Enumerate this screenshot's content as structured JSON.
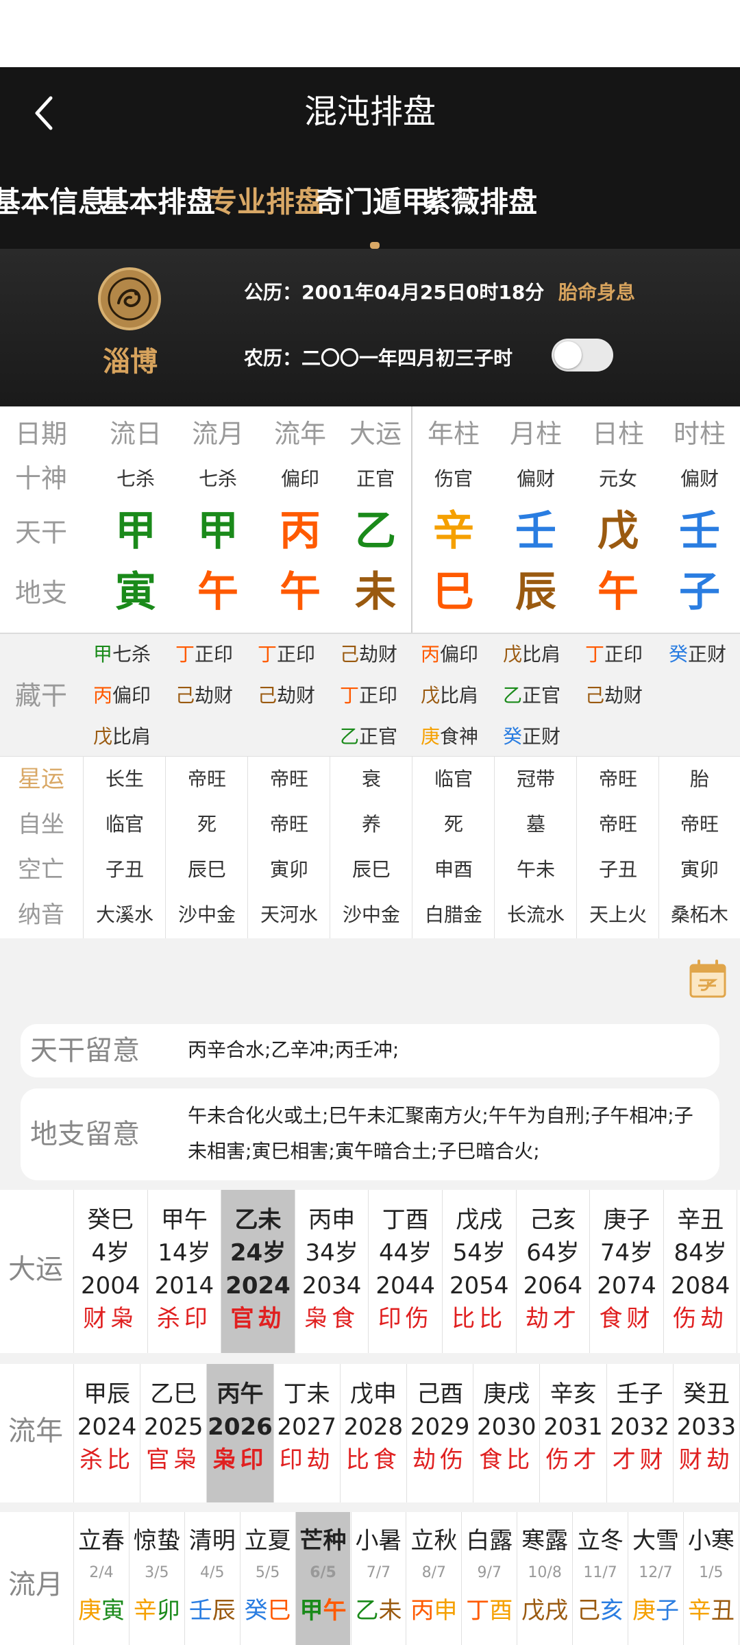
{
  "header": {
    "title": "混沌排盘",
    "back_icon": "chevron-left-icon"
  },
  "tabs": [
    {
      "label": "基本信息",
      "active": false
    },
    {
      "label": "基本排盘",
      "active": false
    },
    {
      "label": "专业排盘",
      "active": true
    },
    {
      "label": "奇门遁甲",
      "active": false
    },
    {
      "label": "紫薇排盘",
      "active": false
    }
  ],
  "info": {
    "place": "淄博",
    "solar": "公历：2001年04月25日0时18分",
    "fetus_label": "胎命身息",
    "lunar": "农历：二〇〇一年四月初三子时",
    "toggle_on": false
  },
  "pillars": {
    "headers": [
      "日期",
      "流日",
      "流月",
      "流年",
      "大运",
      "年柱",
      "月柱",
      "日柱",
      "时柱"
    ],
    "gods_label": "十神",
    "gods": [
      "七杀",
      "七杀",
      "偏印",
      "正官",
      "伤官",
      "偏财",
      "元女",
      "偏财"
    ],
    "stems_label": "天干",
    "stems": [
      {
        "t": "甲",
        "c": "#1a8a1a"
      },
      {
        "t": "甲",
        "c": "#1a8a1a"
      },
      {
        "t": "丙",
        "c": "#ff5a00"
      },
      {
        "t": "乙",
        "c": "#1a8a1a"
      },
      {
        "t": "辛",
        "c": "#f5a000"
      },
      {
        "t": "壬",
        "c": "#2a7de1"
      },
      {
        "t": "戊",
        "c": "#9a5a10"
      },
      {
        "t": "壬",
        "c": "#2a7de1"
      }
    ],
    "branches_label": "地支",
    "branches": [
      {
        "t": "寅",
        "c": "#1a8a1a"
      },
      {
        "t": "午",
        "c": "#ff5a00"
      },
      {
        "t": "午",
        "c": "#ff5a00"
      },
      {
        "t": "未",
        "c": "#9a5a10"
      },
      {
        "t": "巳",
        "c": "#ff5a00"
      },
      {
        "t": "辰",
        "c": "#9a5a10"
      },
      {
        "t": "午",
        "c": "#ff5a00"
      },
      {
        "t": "子",
        "c": "#2a7de1"
      }
    ]
  },
  "hidden": {
    "label": "藏干",
    "columns": [
      [
        {
          "s": "甲",
          "c": "#1a8a1a",
          "g": "七杀"
        },
        {
          "s": "丙",
          "c": "#ff5a00",
          "g": "偏印"
        },
        {
          "s": "戊",
          "c": "#9a5a10",
          "g": "比肩"
        }
      ],
      [
        {
          "s": "丁",
          "c": "#ff5a00",
          "g": "正印"
        },
        {
          "s": "己",
          "c": "#9a5a10",
          "g": "劫财"
        }
      ],
      [
        {
          "s": "丁",
          "c": "#ff5a00",
          "g": "正印"
        },
        {
          "s": "己",
          "c": "#9a5a10",
          "g": "劫财"
        }
      ],
      [
        {
          "s": "己",
          "c": "#9a5a10",
          "g": "劫财"
        },
        {
          "s": "丁",
          "c": "#ff5a00",
          "g": "正印"
        },
        {
          "s": "乙",
          "c": "#1a8a1a",
          "g": "正官"
        }
      ],
      [
        {
          "s": "丙",
          "c": "#ff5a00",
          "g": "偏印"
        },
        {
          "s": "戊",
          "c": "#9a5a10",
          "g": "比肩"
        },
        {
          "s": "庚",
          "c": "#f5a000",
          "g": "食神"
        }
      ],
      [
        {
          "s": "戊",
          "c": "#9a5a10",
          "g": "比肩"
        },
        {
          "s": "乙",
          "c": "#1a8a1a",
          "g": "正官"
        },
        {
          "s": "癸",
          "c": "#2a7de1",
          "g": "正财"
        }
      ],
      [
        {
          "s": "丁",
          "c": "#ff5a00",
          "g": "正印"
        },
        {
          "s": "己",
          "c": "#9a5a10",
          "g": "劫财"
        }
      ],
      [
        {
          "s": "癸",
          "c": "#2a7de1",
          "g": "正财"
        }
      ]
    ]
  },
  "fate": {
    "labels": [
      "星运",
      "自坐",
      "空亡",
      "纳音"
    ],
    "label_colors": [
      "#d9a866",
      "#999999",
      "#999999",
      "#999999"
    ],
    "rows": [
      [
        "长生",
        "帝旺",
        "帝旺",
        "衰",
        "临官",
        "冠带",
        "帝旺",
        "胎"
      ],
      [
        "临官",
        "死",
        "帝旺",
        "养",
        "死",
        "墓",
        "帝旺",
        "帝旺"
      ],
      [
        "子丑",
        "辰巳",
        "寅卯",
        "辰巳",
        "申酉",
        "午未",
        "子丑",
        "寅卯"
      ],
      [
        "大溪水",
        "沙中金",
        "天河水",
        "沙中金",
        "白腊金",
        "长流水",
        "天上火",
        "桑柘木"
      ]
    ]
  },
  "notes": {
    "calendar_icon": "calendar-icon",
    "stem_label": "天干留意",
    "stem_text": "丙辛合水;乙辛冲;丙壬冲;",
    "branch_label": "地支留意",
    "branch_text": "午未合化火或土;巳午未汇聚南方火;午午为自刑;子午相冲;子未相害;寅巳相害;寅午暗合土;子巳暗合火;"
  },
  "dayun": {
    "label": "大运",
    "items": [
      {
        "gz": "癸巳",
        "age": "4岁",
        "year": "2004",
        "god": "财枭"
      },
      {
        "gz": "甲午",
        "age": "14岁",
        "year": "2014",
        "god": "杀印"
      },
      {
        "gz": "乙未",
        "age": "24岁",
        "year": "2024",
        "god": "官劫",
        "selected": true
      },
      {
        "gz": "丙申",
        "age": "34岁",
        "year": "2034",
        "god": "枭食"
      },
      {
        "gz": "丁酉",
        "age": "44岁",
        "year": "2044",
        "god": "印伤"
      },
      {
        "gz": "戊戌",
        "age": "54岁",
        "year": "2054",
        "god": "比比"
      },
      {
        "gz": "己亥",
        "age": "64岁",
        "year": "2064",
        "god": "劫才"
      },
      {
        "gz": "庚子",
        "age": "74岁",
        "year": "2074",
        "god": "食财"
      },
      {
        "gz": "辛丑",
        "age": "84岁",
        "year": "2084",
        "god": "伤劫"
      }
    ]
  },
  "liunian": {
    "label": "流年",
    "items": [
      {
        "gz": "甲辰",
        "year": "2024",
        "god": "杀比"
      },
      {
        "gz": "乙巳",
        "year": "2025",
        "god": "官枭"
      },
      {
        "gz": "丙午",
        "year": "2026",
        "god": "枭印",
        "selected": true
      },
      {
        "gz": "丁未",
        "year": "2027",
        "god": "印劫"
      },
      {
        "gz": "戊申",
        "year": "2028",
        "god": "比食"
      },
      {
        "gz": "己酉",
        "year": "2029",
        "god": "劫伤"
      },
      {
        "gz": "庚戌",
        "year": "2030",
        "god": "食比"
      },
      {
        "gz": "辛亥",
        "year": "2031",
        "god": "伤才"
      },
      {
        "gz": "壬子",
        "year": "2032",
        "god": "才财"
      },
      {
        "gz": "癸丑",
        "year": "2033",
        "god": "财劫"
      }
    ]
  },
  "liuyue": {
    "label": "流月",
    "items": [
      {
        "term": "立春",
        "date": "2/4",
        "s": "庚",
        "sc": "#f5a000",
        "b": "寅",
        "bc": "#1a8a1a"
      },
      {
        "term": "惊蛰",
        "date": "3/5",
        "s": "辛",
        "sc": "#f5a000",
        "b": "卯",
        "bc": "#1a8a1a"
      },
      {
        "term": "清明",
        "date": "4/5",
        "s": "壬",
        "sc": "#2a7de1",
        "b": "辰",
        "bc": "#9a5a10"
      },
      {
        "term": "立夏",
        "date": "5/5",
        "s": "癸",
        "sc": "#2a7de1",
        "b": "巳",
        "bc": "#ff5a00"
      },
      {
        "term": "芒种",
        "date": "6/5",
        "s": "甲",
        "sc": "#1a8a1a",
        "b": "午",
        "bc": "#ff5a00",
        "selected": true
      },
      {
        "term": "小暑",
        "date": "7/7",
        "s": "乙",
        "sc": "#1a8a1a",
        "b": "未",
        "bc": "#9a5a10"
      },
      {
        "term": "立秋",
        "date": "8/7",
        "s": "丙",
        "sc": "#ff5a00",
        "b": "申",
        "bc": "#f5a000"
      },
      {
        "term": "白露",
        "date": "9/7",
        "s": "丁",
        "sc": "#ff5a00",
        "b": "酉",
        "bc": "#f5a000"
      },
      {
        "term": "寒露",
        "date": "10/8",
        "s": "戊",
        "sc": "#9a5a10",
        "b": "戌",
        "bc": "#9a5a10"
      },
      {
        "term": "立冬",
        "date": "11/7",
        "s": "己",
        "sc": "#9a5a10",
        "b": "亥",
        "bc": "#2a7de1"
      },
      {
        "term": "大雪",
        "date": "12/7",
        "s": "庚",
        "sc": "#f5a000",
        "b": "子",
        "bc": "#2a7de1"
      },
      {
        "term": "小寒",
        "date": "1/5",
        "s": "辛",
        "sc": "#f5a000",
        "b": "丑",
        "bc": "#9a5a10"
      }
    ]
  }
}
